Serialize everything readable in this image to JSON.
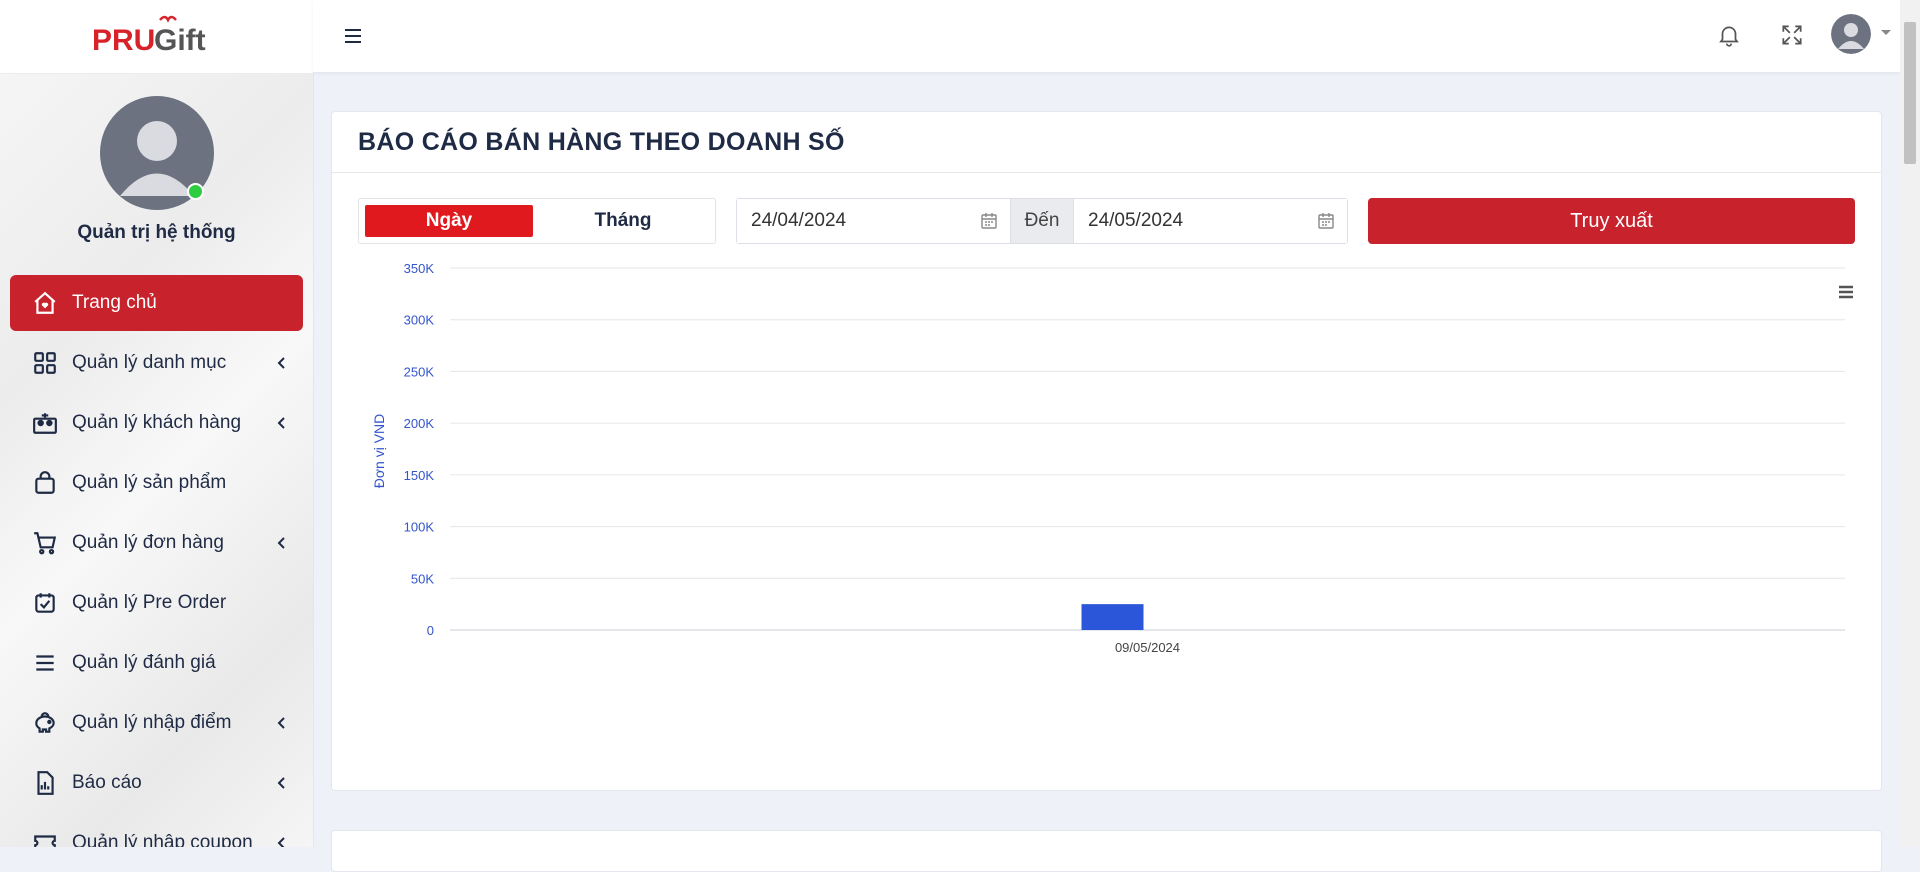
{
  "brand": {
    "logo_text_a": "PRU",
    "logo_text_b": "Gift",
    "primary_color": "#c8232c"
  },
  "profile": {
    "name": "Quản trị hệ thống",
    "status_color": "#2ecc40"
  },
  "sidebar": {
    "items": [
      {
        "label": "Trang chủ",
        "icon": "home-icon",
        "active": true,
        "has_submenu": false
      },
      {
        "label": "Quản lý danh mục",
        "icon": "grid-icon",
        "active": false,
        "has_submenu": true
      },
      {
        "label": "Quản lý khách hàng",
        "icon": "people-icon",
        "active": false,
        "has_submenu": true
      },
      {
        "label": "Quản lý sản phẩm",
        "icon": "bag-icon",
        "active": false,
        "has_submenu": false
      },
      {
        "label": "Quản lý đơn hàng",
        "icon": "cart-icon",
        "active": false,
        "has_submenu": true
      },
      {
        "label": "Quản lý Pre Order",
        "icon": "calendar-check-icon",
        "active": false,
        "has_submenu": false
      },
      {
        "label": "Quản lý đánh giá",
        "icon": "list-icon",
        "active": false,
        "has_submenu": false
      },
      {
        "label": "Quản lý nhập điểm",
        "icon": "piggy-bank-icon",
        "active": false,
        "has_submenu": true
      },
      {
        "label": "Báo cáo",
        "icon": "report-icon",
        "active": false,
        "has_submenu": true
      },
      {
        "label": "Quản lý nhập coupon",
        "icon": "ticket-icon",
        "active": false,
        "has_submenu": true
      }
    ]
  },
  "topbar": {
    "icons": [
      "hamburger-icon",
      "bell-icon",
      "fullscreen-icon",
      "user-avatar"
    ]
  },
  "report": {
    "title": "BÁO CÁO BÁN HÀNG THEO DOANH SỐ",
    "toggle_day": "Ngày",
    "toggle_month": "Tháng",
    "selected_toggle": "Ngày",
    "from_date": "24/04/2024",
    "to_label": "Đến",
    "to_date": "24/05/2024",
    "query_button": "Truy xuất"
  },
  "chart_data": {
    "type": "bar",
    "categories": [
      "09/05/2024"
    ],
    "values": [
      25000
    ],
    "title": "",
    "xlabel": "",
    "ylabel": "Đơn vị VND",
    "ylim": [
      0,
      350000
    ],
    "yticks": [
      0,
      50000,
      100000,
      150000,
      200000,
      250000,
      300000,
      350000
    ],
    "ytick_labels": [
      "0",
      "50K",
      "100K",
      "150K",
      "200K",
      "250K",
      "300K",
      "350K"
    ],
    "grid": true,
    "bar_color": "#2b56d9"
  }
}
